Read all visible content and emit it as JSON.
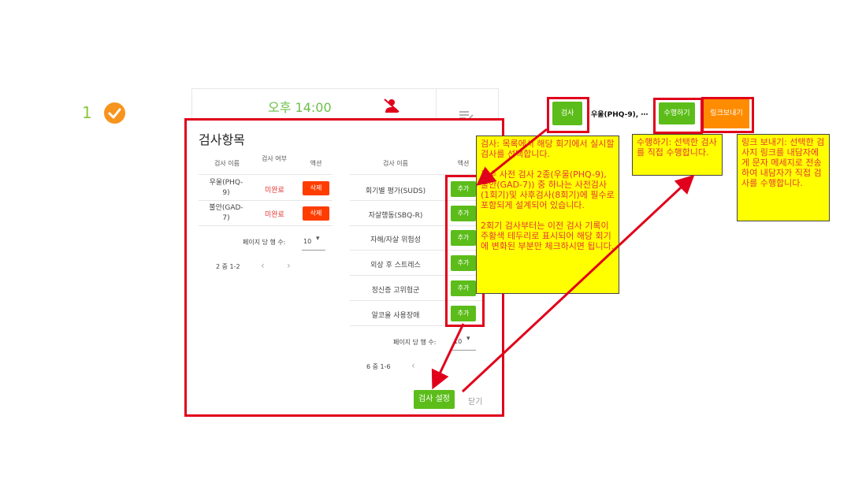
{
  "session": {
    "number": "1",
    "time": "오후 14:00"
  },
  "panel": {
    "title": "검사항목",
    "selected_table": {
      "headers": [
        "검사 이름",
        "검사 여부",
        "액션"
      ],
      "rows": [
        {
          "name": "우울(PHQ-9)",
          "status": "미완료",
          "action": "삭제"
        },
        {
          "name": "불안(GAD-7)",
          "status": "미완료",
          "action": "삭제"
        }
      ],
      "rows_per_page_label": "페이지 당 행 수:",
      "rows_per_page_value": "10",
      "range": "2 중 1-2"
    },
    "available_table": {
      "headers": [
        "검사 이름",
        "액션"
      ],
      "rows": [
        {
          "name": "회기별 평가(SUDS)",
          "action": "추가"
        },
        {
          "name": "자살행동(SBQ-R)",
          "action": "추가"
        },
        {
          "name": "자해/자살 위험성",
          "action": "추가"
        },
        {
          "name": "외상 후 스트레스",
          "action": "추가"
        },
        {
          "name": "정신증 고위험군",
          "action": "추가"
        },
        {
          "name": "알코올 사용장애",
          "action": "추가"
        }
      ],
      "rows_per_page_label": "페이지 당 행 수:",
      "rows_per_page_value": "10",
      "range": "6 중 1-6"
    },
    "setup_button": "검사 설정",
    "close_button": "닫기"
  },
  "toolbar": {
    "exam_button": "검사",
    "exam_summary": "우울(PHQ-9), ⋯",
    "perform_button": "수행하기",
    "send_link_button": "링크보내기"
  },
  "notes": {
    "exam": [
      "검사: 목록에서 해당 회기에서 실시할 검사를 선택합니다.",
      "필수 사전 검사 2종(우울(PHQ-9), 불안(GAD-7)) 중 하나는 사전검사(1회기)및 사후검사(8회기)에 필수로 포함되게 설계되어 있습니다.",
      "2회기 검사부터는 이전 검사 기록이 주황색 테두리로 표시되어 해당 회기에 변화된 부분만 체크하시면 됩니다."
    ],
    "perform": "수행하기: 선택한 검사를 직접 수행합니다.",
    "send_link": "링크 보내기: 선택한 검사지 링크를 내담자에게 문자 메세지로 전송하여 내담자가 직접 검사를 수행합니다."
  },
  "colors": {
    "green": "#5cbd1a",
    "red": "#e0001b",
    "orange": "#ff8c00",
    "note_bg": "#ffff00",
    "note_text": "#e53935"
  }
}
